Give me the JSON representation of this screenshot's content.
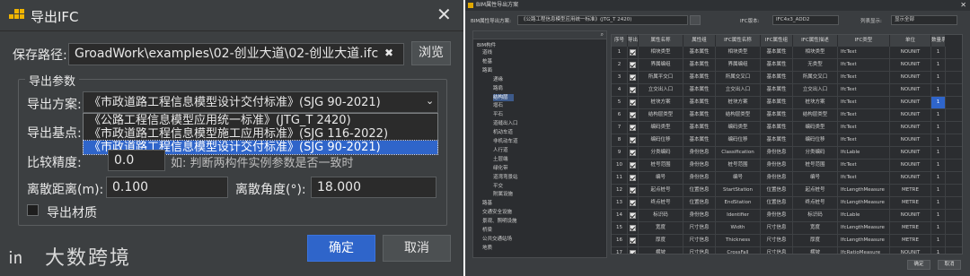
{
  "left_dialog": {
    "title": "导出IFC",
    "save_path_label": "保存路径:",
    "save_path_value": "GroadWork\\examples\\02-创业大道\\02-创业大道.ifc",
    "clear_glyph": "✖",
    "browse_label": "浏览",
    "export_params_group": "导出参数",
    "scheme_label": "导出方案:",
    "scheme_selected": "《市政道路工程信息模型设计交付标准》(SJG 90-2021)",
    "scheme_options": [
      "《公路工程信息模型应用统一标准》(JTG_T 2420)",
      "《市政道路工程信息模型施工应用标准》(SJG 116-2022)",
      "《市政道路工程信息模型设计交付标准》(SJG 90-2021)"
    ],
    "base_point_label": "导出基点:",
    "precision_label": "比较精度:",
    "precision_value": "0.0",
    "precision_hint": "如: 判断两构件实例参数是否一致时",
    "discrete_distance_label": "离散距离(m):",
    "discrete_distance_value": "0.100",
    "discrete_angle_label": "离散角度(°):",
    "discrete_angle_value": "18.000",
    "export_material_label": "导出材质",
    "ok_label": "确定",
    "cancel_label": "取消",
    "watermark": "大数跨境"
  },
  "right_window": {
    "title": "BIM属性导出方案",
    "scheme_label": "BIM属性导出方案:",
    "scheme_value": "《公路工程信息模型应用统一标准》(JTG_T 2420)",
    "ifc_version_label": "IFC版本:",
    "ifc_version_value": "IFC4x3_ADD2",
    "list_display_label": "列表显示:",
    "list_display_value": "显示全部",
    "tree_root": "BIM构件",
    "tree_items": [
      "道线",
      "桩基",
      "路面",
      "递缘",
      "路肩",
      "结构层",
      "增石",
      "平石",
      "道缝出入口",
      "机动车道",
      "非机动车道",
      "人行道",
      "土层端",
      "绿化带",
      "道湾弯景站",
      "平交",
      "附属设施",
      "路基",
      "交通安全设施",
      "景观、照明设施",
      "桥梁",
      "公共交通站场",
      "地质"
    ],
    "columns": [
      "序号",
      "导出",
      "属性名称",
      "属性组",
      "IFC属性名称",
      "IFC属性组",
      "IFC属性描述",
      "IFC类型",
      "单位",
      "数量系数"
    ],
    "rows": [
      [
        "1",
        "",
        "相块类型",
        "基本属性",
        "相块类型",
        "基本属性",
        "相块类型",
        "IfcText",
        "NOUNIT",
        "1"
      ],
      [
        "2",
        "",
        "界属编组",
        "基本属性",
        "界属编组",
        "基本属性",
        "无类型",
        "IfcText",
        "NOUNIT",
        "1"
      ],
      [
        "3",
        "",
        "所属平交口",
        "基本属性",
        "所属交叉口",
        "基本属性",
        "所属交叉口",
        "IfcText",
        "NOUNIT",
        "1"
      ],
      [
        "4",
        "",
        "立交出入口",
        "基本属性",
        "立交出入口",
        "基本属性",
        "立交出入口",
        "IfcText",
        "NOUNIT",
        "1"
      ],
      [
        "5",
        "",
        "桩块方案",
        "基本属性",
        "桩块方案",
        "基本属性",
        "桩块方案",
        "IfcText",
        "NOUNIT",
        "1"
      ],
      [
        "6",
        "",
        "结构层类型",
        "基本属性",
        "结构层类型",
        "基本属性",
        "结构层类型",
        "IfcText",
        "NOUNIT",
        "1"
      ],
      [
        "7",
        "",
        "编码类型",
        "基本属性",
        "编码类型",
        "基本属性",
        "编码类型",
        "IfcText",
        "NOUNIT",
        "1"
      ],
      [
        "8",
        "",
        "编码位移",
        "基本属性",
        "编码位移",
        "基本属性",
        "编码位移",
        "IfcText",
        "NOUNIT",
        "1"
      ],
      [
        "9",
        "",
        "分类编码",
        "身份信息",
        "Classification",
        "身份信息",
        "分类编码",
        "IfcLable",
        "NOUNIT",
        "1"
      ],
      [
        "10",
        "",
        "桩号范围",
        "身份信息",
        "桩号范围",
        "身份信息",
        "桩号范围",
        "IfcText",
        "NOUNIT",
        "1"
      ],
      [
        "11",
        "",
        "编号",
        "身份信息",
        "编号",
        "身份信息",
        "编号",
        "IfcText",
        "NOUNIT",
        "1"
      ],
      [
        "12",
        "",
        "起点桩号",
        "位置信息",
        "StartStation",
        "位置信息",
        "起点桩号",
        "IfcLengthMeasure",
        "METRE",
        "1"
      ],
      [
        "13",
        "",
        "终点桩号",
        "位置信息",
        "EndStation",
        "位置信息",
        "终点桩号",
        "IfcLengthMeasure",
        "METRE",
        "1"
      ],
      [
        "14",
        "",
        "标识码",
        "身份信息",
        "Identifier",
        "身份信息",
        "标识码",
        "IfcLable",
        "NOUNIT",
        "1"
      ],
      [
        "15",
        "",
        "宽度",
        "尺寸信息",
        "Width",
        "尺寸信息",
        "宽度",
        "IfcLengthMeasure",
        "METRE",
        "1"
      ],
      [
        "16",
        "",
        "厚度",
        "尺寸信息",
        "Thickness",
        "尺寸信息",
        "厚度",
        "IfcLengthMeasure",
        "METRE",
        "1"
      ],
      [
        "17",
        "",
        "横坡",
        "尺寸信息",
        "CrossFall",
        "尺寸信息",
        "横坡",
        "IfcRatioMeasure",
        "NOUNIT",
        "1"
      ]
    ],
    "ok_label": "确定",
    "cancel_label": "取消"
  }
}
